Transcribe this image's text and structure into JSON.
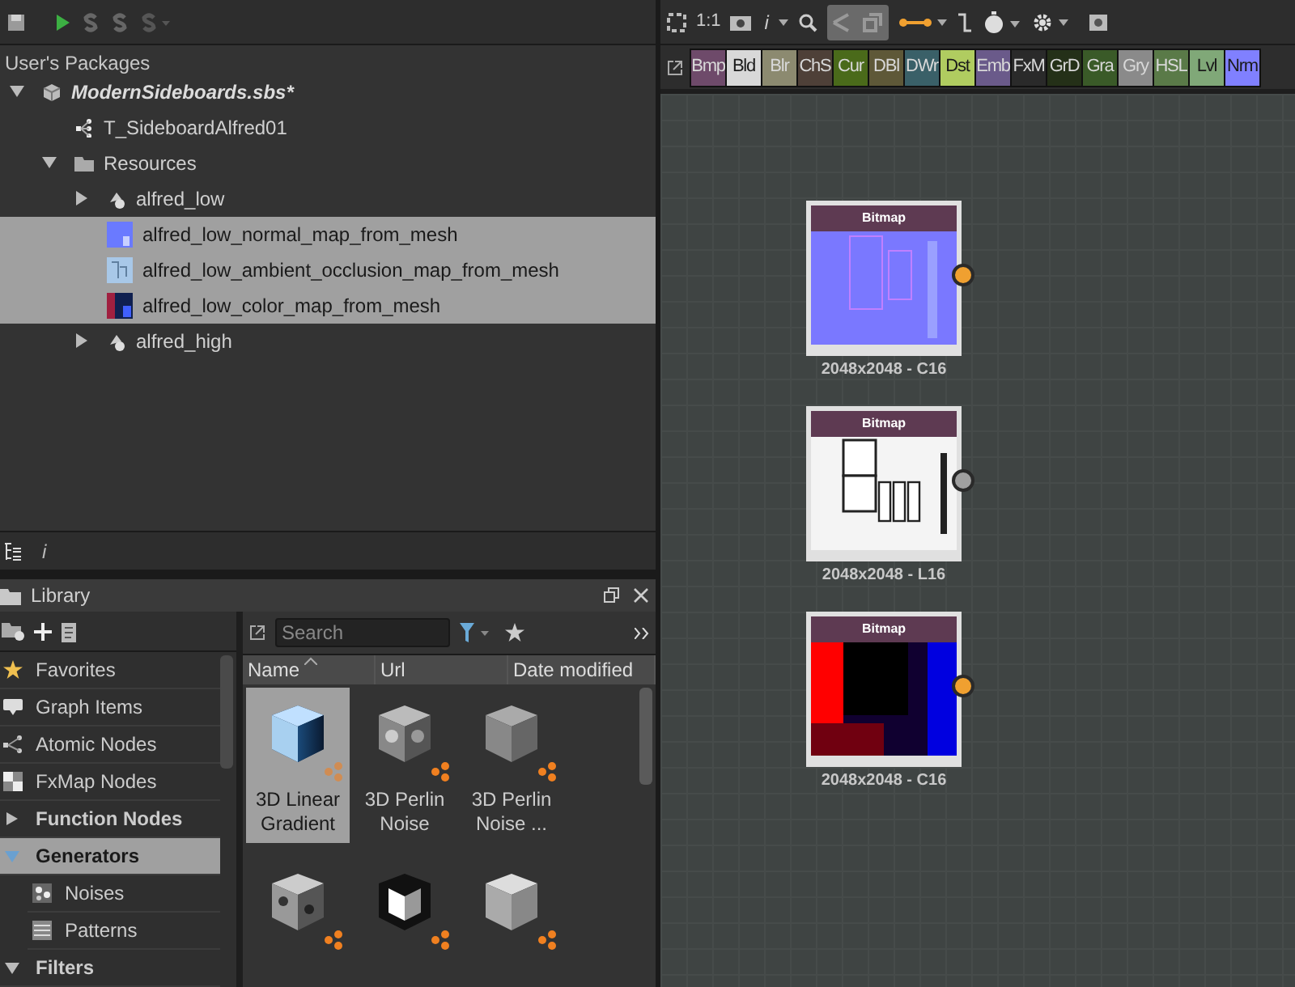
{
  "explorer": {
    "header": "User's Packages",
    "tree": [
      {
        "label": "ModernSideboards.sbs*",
        "kind": "package",
        "expanded": true,
        "selected": false,
        "children": [
          {
            "label": "T_SideboardAlfred01",
            "kind": "graph",
            "selected": false
          },
          {
            "label": "Resources",
            "kind": "folder",
            "expanded": true,
            "selected": false,
            "children": [
              {
                "label": "alfred_low",
                "kind": "mesh",
                "expanded": false,
                "selected": false
              },
              {
                "label": "alfred_low_normal_map_from_mesh",
                "kind": "normal",
                "selected": true
              },
              {
                "label": "alfred_low_ambient_occlusion_map_from_mesh",
                "kind": "ao",
                "selected": true
              },
              {
                "label": "alfred_low_color_map_from_mesh",
                "kind": "color",
                "selected": true
              },
              {
                "label": "alfred_high",
                "kind": "mesh",
                "expanded": false,
                "selected": false
              }
            ]
          }
        ]
      }
    ]
  },
  "info_tab": "i",
  "library": {
    "title": "Library",
    "search": {
      "placeholder": "Search"
    },
    "columns": [
      {
        "label": "Name",
        "sorted": true
      },
      {
        "label": "Url",
        "sorted": false
      },
      {
        "label": "Date modified",
        "sorted": false
      }
    ],
    "categories": [
      {
        "label": "Favorites",
        "kind": "item",
        "selected": false
      },
      {
        "label": "Graph Items",
        "kind": "item",
        "selected": false
      },
      {
        "label": "Atomic Nodes",
        "kind": "item",
        "selected": false
      },
      {
        "label": "FxMap Nodes",
        "kind": "item",
        "selected": false
      },
      {
        "label": "Function Nodes",
        "kind": "group",
        "expanded": false,
        "selected": false
      },
      {
        "label": "Generators",
        "kind": "group",
        "expanded": true,
        "selected": true
      },
      {
        "label": "Noises",
        "kind": "sub",
        "selected": false
      },
      {
        "label": "Patterns",
        "kind": "sub",
        "selected": false
      },
      {
        "label": "Filters",
        "kind": "group",
        "expanded": true,
        "selected": false
      }
    ],
    "items": [
      {
        "label": "3D Linear Gradient",
        "kind": "gradient",
        "selected": true
      },
      {
        "label": "3D Perlin Noise",
        "kind": "perlin",
        "selected": false
      },
      {
        "label": "3D Perlin Noise ...",
        "kind": "fine",
        "selected": false
      },
      {
        "kind": "cells",
        "selected": false
      },
      {
        "kind": "glow",
        "selected": false
      },
      {
        "kind": "soft",
        "selected": false
      }
    ]
  },
  "graph": {
    "zoom_label": "1:1",
    "info_label": "i",
    "palette": [
      {
        "label": "Bmp",
        "color": "#6e4a6a"
      },
      {
        "label": "Bld",
        "color": "#d8d8d8"
      },
      {
        "label": "Blr",
        "color": "#8c8a70"
      },
      {
        "label": "ChS",
        "color": "#4e4038"
      },
      {
        "label": "Cur",
        "color": "#4a6a1a"
      },
      {
        "label": "DBl",
        "color": "#5e5838"
      },
      {
        "label": "DWr",
        "color": "#3a6068"
      },
      {
        "label": "Dst",
        "color": "#b0cc60"
      },
      {
        "label": "Emb",
        "color": "#6a5a8a"
      },
      {
        "label": "FxM",
        "color": "#2a2a2a"
      },
      {
        "label": "GrD",
        "color": "#243018"
      },
      {
        "label": "Gra",
        "color": "#3a5a28"
      },
      {
        "label": "Gry",
        "color": "#8a8a8a"
      },
      {
        "label": "HSL",
        "color": "#5a7a48"
      },
      {
        "label": "Lvl",
        "color": "#80a878"
      },
      {
        "label": "Nrm",
        "color": "#8080ff"
      }
    ],
    "nodes": [
      {
        "title": "Bitmap",
        "caption": "2048x2048 - C16",
        "kind": "normal"
      },
      {
        "title": "Bitmap",
        "caption": "2048x2048 - L16",
        "kind": "ao"
      },
      {
        "title": "Bitmap",
        "caption": "2048x2048 - C16",
        "kind": "color"
      }
    ]
  }
}
